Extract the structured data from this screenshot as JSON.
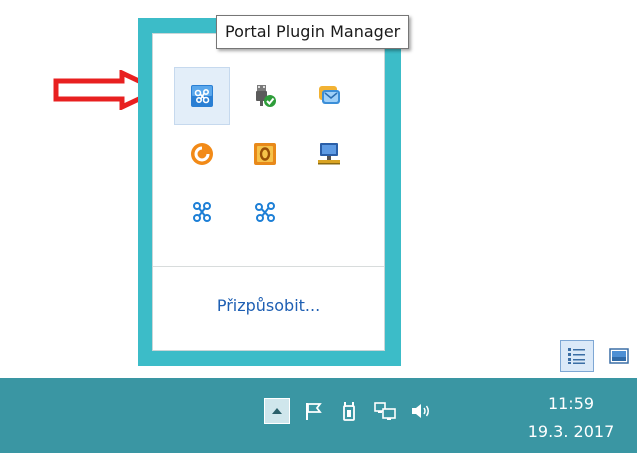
{
  "tooltip": {
    "text": "Portal Plugin Manager"
  },
  "flyout": {
    "customize_label": "Přizpůsobit...",
    "icons": [
      {
        "name": "portal-plugin-manager-icon",
        "selected": true
      },
      {
        "name": "usb-safely-remove-icon",
        "selected": false
      },
      {
        "name": "messenger-icon",
        "selected": false
      },
      {
        "name": "avast-antivirus-icon",
        "selected": false
      },
      {
        "name": "office-app-icon",
        "selected": false
      },
      {
        "name": "network-computer-icon",
        "selected": false
      },
      {
        "name": "bluetooth-network-icon",
        "selected": false
      },
      {
        "name": "plugin-network-icon",
        "selected": false
      }
    ]
  },
  "taskbar": {
    "time": "11:59",
    "date": "19.3. 2017",
    "tray_icons": [
      "show-hidden-icons-icon",
      "flag-icon",
      "power-icon",
      "network-icon",
      "volume-icon"
    ]
  },
  "colors": {
    "flyout_border": "#3cbcc8",
    "taskbar": "#3a96a3",
    "link": "#1e5fb3",
    "arrow": "#e82020"
  }
}
